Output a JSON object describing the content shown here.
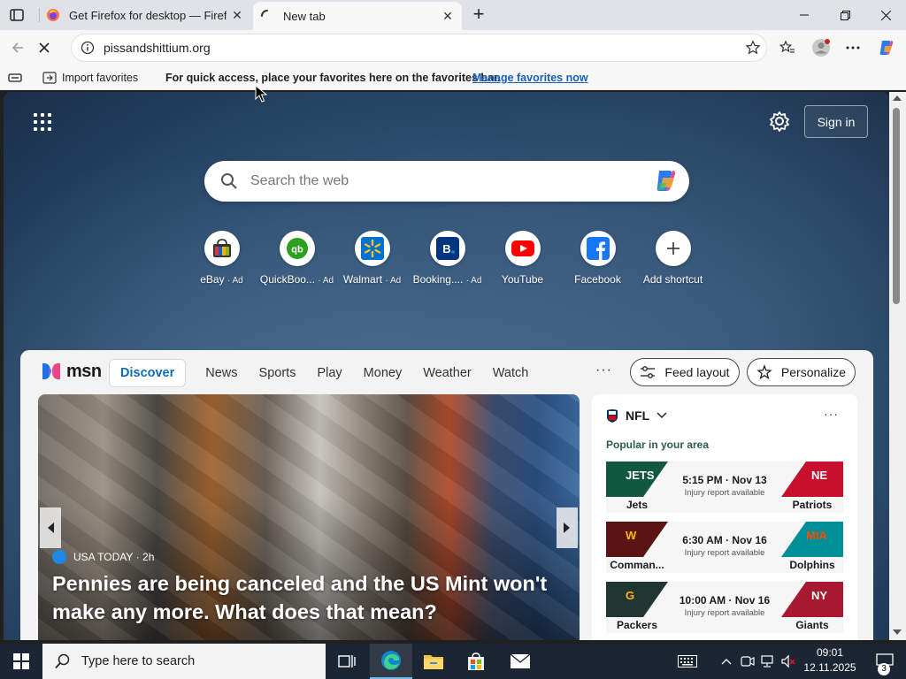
{
  "browser": {
    "tabs": [
      {
        "title": "Get Firefox for desktop — Firefox",
        "icon": "firefox-icon",
        "active": false
      },
      {
        "title": "New tab",
        "icon": "loading-spinner-icon",
        "active": true
      }
    ],
    "address": {
      "url": "pissandshittium.org"
    },
    "favorites_bar": {
      "import_label": "Import favorites",
      "message": "For quick access, place your favorites here on the favorites bar.",
      "manage_link": "Manage favorites now"
    }
  },
  "newtab": {
    "signin_label": "Sign in",
    "search": {
      "placeholder": "Search the web"
    },
    "shortcuts": [
      {
        "label": "eBay",
        "ad": "· Ad",
        "icon": "ebay-icon"
      },
      {
        "label": "QuickBoo...",
        "ad": "· Ad",
        "icon": "quickbooks-icon"
      },
      {
        "label": "Walmart",
        "ad": "· Ad",
        "icon": "walmart-icon"
      },
      {
        "label": "Booking....",
        "ad": "· Ad",
        "icon": "booking-icon"
      },
      {
        "label": "YouTube",
        "ad": "",
        "icon": "youtube-icon"
      },
      {
        "label": "Facebook",
        "ad": "",
        "icon": "facebook-icon"
      },
      {
        "label": "Add shortcut",
        "ad": "",
        "icon": "plus-icon"
      }
    ]
  },
  "feed": {
    "logo_text": "msn",
    "nav": [
      {
        "label": "Discover",
        "active": true
      },
      {
        "label": "News"
      },
      {
        "label": "Sports"
      },
      {
        "label": "Play"
      },
      {
        "label": "Money"
      },
      {
        "label": "Weather"
      },
      {
        "label": "Watch"
      }
    ],
    "more_label": "···",
    "feed_layout_label": "Feed layout",
    "personalize_label": "Personalize",
    "hero": {
      "source": "USA TODAY",
      "age": "· 2h",
      "headline": "Pennies are being canceled and the US Mint won't make any more. What does that mean?"
    },
    "nfl": {
      "title": "NFL",
      "subtitle": "Popular in your area",
      "more_label": "···",
      "games": [
        {
          "home": "Jets",
          "away": "Patriots",
          "time": "5:15 PM · Nov 13",
          "note": "Injury report available",
          "home_color": "#125740",
          "away_color": "#c8102e"
        },
        {
          "home": "Comman...",
          "away": "Dolphins",
          "time": "6:30 AM · Nov 16",
          "note": "Injury report available",
          "home_color": "#5a1414",
          "away_color": "#008e97"
        },
        {
          "home": "Packers",
          "away": "Giants",
          "time": "10:00 AM · Nov 16",
          "note": "Injury report available",
          "home_color": "#203731",
          "away_color": "#a71930"
        }
      ]
    }
  },
  "taskbar": {
    "search_placeholder": "Type here to search",
    "time": "09:01",
    "date": "12.11.2025",
    "notification_count": "3"
  }
}
